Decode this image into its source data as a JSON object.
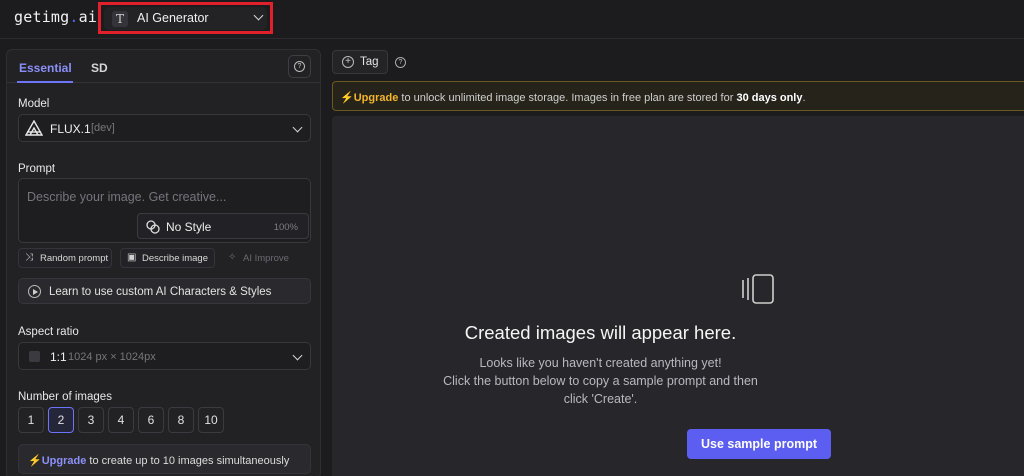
{
  "app": {
    "logo_main": "getimg",
    "logo_dot": ".",
    "logo_tail": "ai",
    "tool_selector": {
      "label": "AI Generator",
      "icon": "T"
    }
  },
  "tabs": [
    {
      "label": "Essential",
      "active": true
    },
    {
      "label": "SD",
      "active": false
    }
  ],
  "model": {
    "section_label": "Model",
    "name": "FLUX.1",
    "variant": "[dev]"
  },
  "prompt": {
    "section_label": "Prompt",
    "placeholder": "Describe your image. Get creative...",
    "style_label": "No Style",
    "style_strength": "100%",
    "actions": {
      "random": "Random prompt",
      "describe": "Describe image",
      "improve": "AI Improve"
    },
    "learn_label": "Learn to use custom AI Characters & Styles"
  },
  "aspect": {
    "section_label": "Aspect ratio",
    "ratio": "1:1",
    "dimensions": "1024 px × 1024px"
  },
  "images": {
    "section_label": "Number of images",
    "options": [
      "1",
      "2",
      "3",
      "4",
      "6",
      "8",
      "10"
    ],
    "selected": "2"
  },
  "upgrade_panel": {
    "link": "Upgrade",
    "text": " to create up to 10 images simultaneously"
  },
  "toolbar": {
    "tag_label": "Tag"
  },
  "notice": {
    "link": "Upgrade",
    "text_before": " to unlock unlimited image storage. Images in free plan are stored for ",
    "strong": "30 days only",
    "text_after": "."
  },
  "empty_state": {
    "title": "Created images will appear here.",
    "line1": "Looks like you haven't created anything yet!",
    "line2": "Click the button below to copy a sample prompt and then",
    "line3": "click 'Create'.",
    "button": "Use sample prompt"
  },
  "colors": {
    "accent": "#5b5ef0",
    "highlight_box": "#e0202b",
    "upgrade_yellow": "#f3b52a"
  }
}
